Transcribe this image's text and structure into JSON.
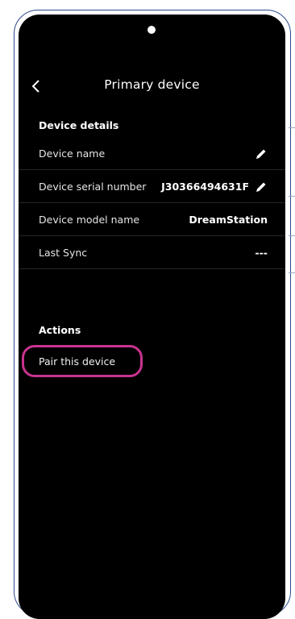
{
  "header": {
    "title": "Primary device",
    "back_icon": "chevron-left-icon"
  },
  "device_details": {
    "heading": "Device details",
    "rows": [
      {
        "label": "Device name",
        "value": "",
        "editable": true
      },
      {
        "label": "Device serial number",
        "value": "J30366494631F",
        "editable": true
      },
      {
        "label": "Device model name",
        "value": "DreamStation",
        "editable": false
      },
      {
        "label": "Last Sync",
        "value": "---",
        "editable": false
      }
    ]
  },
  "actions": {
    "heading": "Actions",
    "pair_label": "Pair this device",
    "highlight_color": "#c9338f"
  },
  "colors": {
    "screen_bg": "#000000",
    "text": "#ffffff",
    "frame": "#2b4a8a"
  }
}
